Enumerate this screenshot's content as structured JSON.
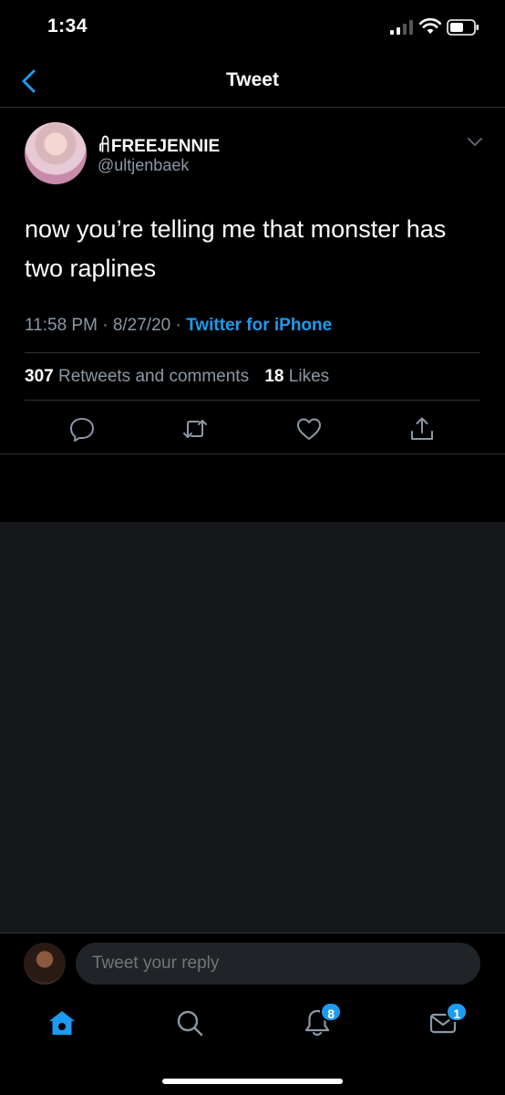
{
  "status": {
    "time": "1:34"
  },
  "nav": {
    "title": "Tweet"
  },
  "tweet": {
    "display_name": "ꋬFREEJENNIE",
    "handle": "@ultjenbaek",
    "text": "now you’re telling me that monster has two raplines",
    "time": "11:58 PM",
    "date": "8/27/20",
    "separator": "·",
    "source": "Twitter for iPhone",
    "retweets_count": "307",
    "retweets_label": "Retweets and comments",
    "likes_count": "18",
    "likes_label": "Likes"
  },
  "reply": {
    "placeholder": "Tweet your reply"
  },
  "tabs": {
    "notifications_badge": "8",
    "messages_badge": "1"
  },
  "colors": {
    "accent": "#1d9bf0",
    "secondary_text": "#8b98a5",
    "background": "#000000",
    "divider": "#2f3336",
    "empty_area": "#16171a"
  }
}
